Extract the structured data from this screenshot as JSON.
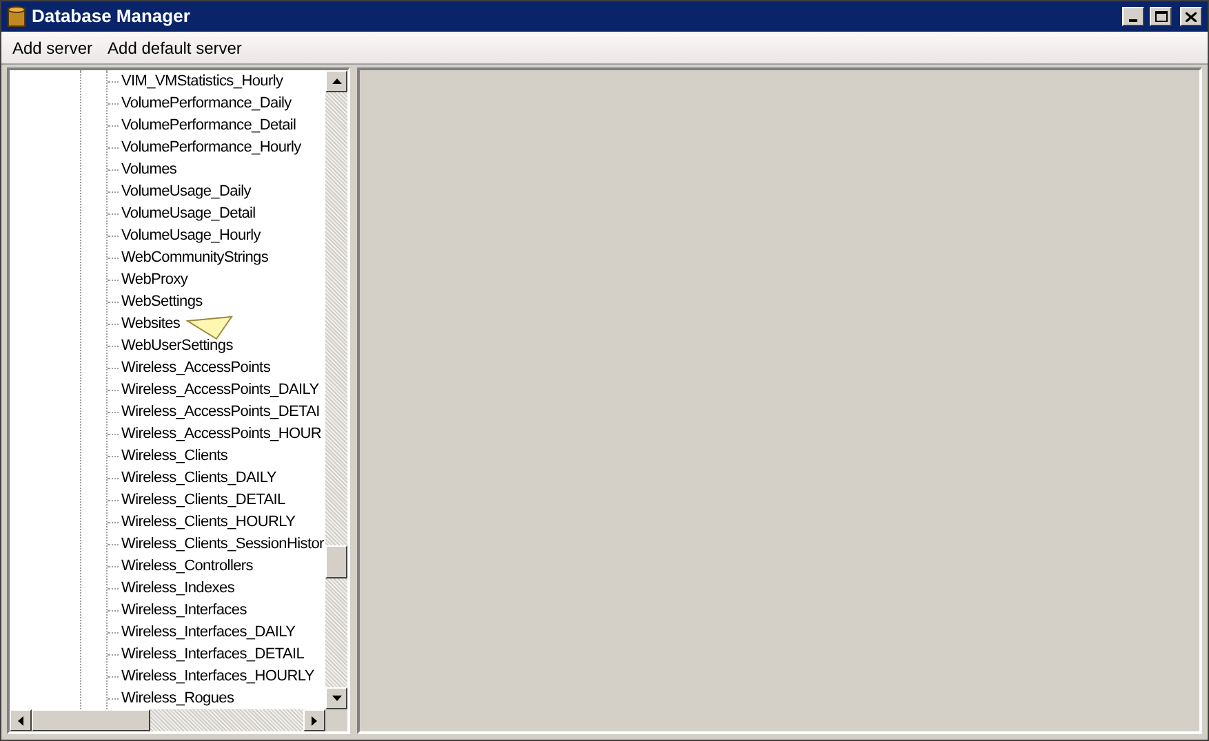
{
  "window": {
    "title": "Database Manager"
  },
  "menu": [
    "Add server",
    "Add default server"
  ],
  "tree": {
    "items": [
      {
        "label": "VIM_VMStatistics_Hourly"
      },
      {
        "label": "VolumePerformance_Daily"
      },
      {
        "label": "VolumePerformance_Detail"
      },
      {
        "label": "VolumePerformance_Hourly"
      },
      {
        "label": "Volumes"
      },
      {
        "label": "VolumeUsage_Daily"
      },
      {
        "label": "VolumeUsage_Detail"
      },
      {
        "label": "VolumeUsage_Hourly"
      },
      {
        "label": "WebCommunityStrings"
      },
      {
        "label": "WebProxy"
      },
      {
        "label": "WebSettings"
      },
      {
        "label": "Websites"
      },
      {
        "label": "WebUserSettings"
      },
      {
        "label": "Wireless_AccessPoints"
      },
      {
        "label": "Wireless_AccessPoints_DAILY"
      },
      {
        "label": "Wireless_AccessPoints_DETAI"
      },
      {
        "label": "Wireless_AccessPoints_HOUR"
      },
      {
        "label": "Wireless_Clients"
      },
      {
        "label": "Wireless_Clients_DAILY"
      },
      {
        "label": "Wireless_Clients_DETAIL"
      },
      {
        "label": "Wireless_Clients_HOURLY"
      },
      {
        "label": "Wireless_Clients_SessionHistor"
      },
      {
        "label": "Wireless_Controllers"
      },
      {
        "label": "Wireless_Indexes"
      },
      {
        "label": "Wireless_Interfaces"
      },
      {
        "label": "Wireless_Interfaces_DAILY"
      },
      {
        "label": "Wireless_Interfaces_DETAIL"
      },
      {
        "label": "Wireless_Interfaces_HOURLY"
      },
      {
        "label": "Wireless_Rogues"
      }
    ]
  }
}
